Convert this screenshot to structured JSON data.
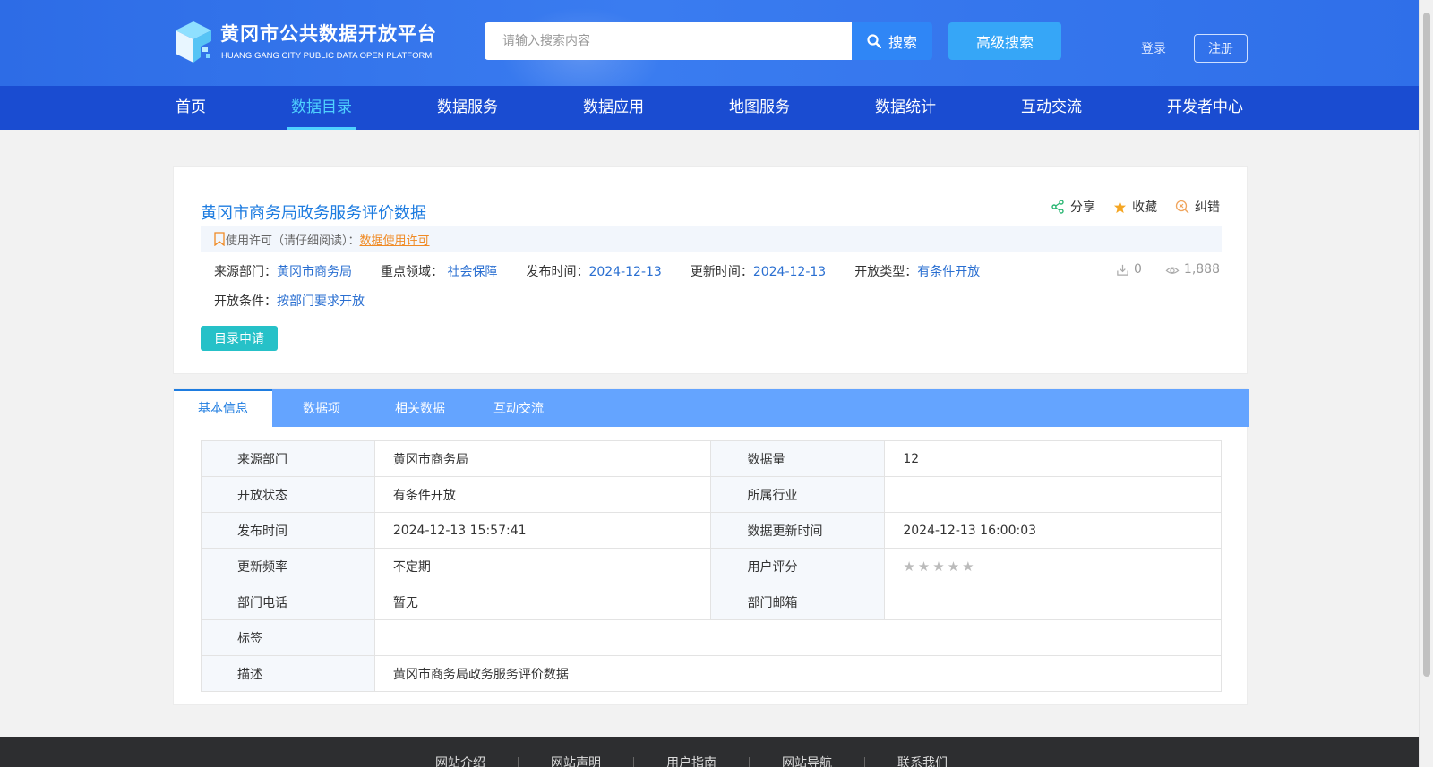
{
  "header": {
    "title": "黄冈市公共数据开放平台",
    "subtitle": "HUANG GANG CITY PUBLIC DATA OPEN  PLATFORM",
    "search_placeholder": "请输入搜索内容",
    "search_button": "搜索",
    "advanced_search": "高级搜索",
    "login": "登录",
    "register": "注册"
  },
  "nav": {
    "items": [
      {
        "label": "首页"
      },
      {
        "label": "数据目录"
      },
      {
        "label": "数据服务"
      },
      {
        "label": "数据应用"
      },
      {
        "label": "地图服务"
      },
      {
        "label": "数据统计"
      },
      {
        "label": "互动交流"
      },
      {
        "label": "开发者中心"
      }
    ],
    "active": "数据目录"
  },
  "dataset": {
    "title": "黄冈市商务局政务服务评价数据",
    "actions": {
      "share": "分享",
      "favorite": "收藏",
      "report": "纠错"
    },
    "license_label": "使用许可（请仔细阅读）：",
    "license_link": "数据使用许可",
    "meta": {
      "source_label": "来源部门：",
      "source": "黄冈市商务局",
      "domain_label": "重点领域：",
      "domain": "社会保障",
      "published_label": "发布时间：",
      "published": "2024-12-13",
      "updated_label": "更新时间：",
      "updated": "2024-12-13",
      "open_type_label": "开放类型：",
      "open_type": "有条件开放",
      "open_cond_label": "开放条件：",
      "open_cond": "按部门要求开放"
    },
    "downloads": "0",
    "views": "1,888",
    "apply_button": "目录申请"
  },
  "tabs": [
    {
      "label": "基本信息"
    },
    {
      "label": "数据项"
    },
    {
      "label": "相关数据"
    },
    {
      "label": "互动交流"
    }
  ],
  "info_table": {
    "source_dept_label": "来源部门",
    "source_dept": "黄冈市商务局",
    "data_volume_label": "数据量",
    "data_volume": "12",
    "open_status_label": "开放状态",
    "open_status": "有条件开放",
    "industry_label": "所属行业",
    "industry": "",
    "publish_time_label": "发布时间",
    "publish_time": "2024-12-13 15:57:41",
    "update_time_label": "数据更新时间",
    "update_time": "2024-12-13 16:00:03",
    "frequency_label": "更新频率",
    "frequency": "不定期",
    "rating_label": "用户评分",
    "rating": 0,
    "phone_label": "部门电话",
    "phone": "暂无",
    "email_label": "部门邮箱",
    "email": "",
    "tags_label": "标签",
    "tags": "",
    "desc_label": "描述",
    "desc": "黄冈市商务局政务服务评价数据"
  },
  "footer": {
    "links": [
      {
        "label": "网站介绍"
      },
      {
        "label": "网站声明"
      },
      {
        "label": "用户指南"
      },
      {
        "label": "网站导航"
      },
      {
        "label": "联系我们"
      }
    ]
  }
}
